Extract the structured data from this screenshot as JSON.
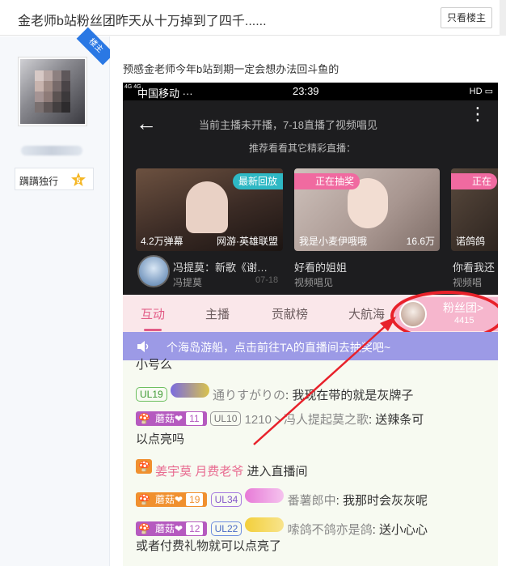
{
  "topbar": {
    "title": "金老师b站粉丝团昨天从十万掉到了四千......",
    "only_host_label": "只看楼主"
  },
  "sidebar": {
    "host_tag": "楼主",
    "level_name": "蹒蹒独行",
    "level_number": "5"
  },
  "post": {
    "text": "预感金老师今年b站到期一定会想办法回斗鱼的"
  },
  "phone": {
    "status": {
      "carrier": "中国移动 ···",
      "time": "23:39",
      "network": "4G 4G",
      "icons": "HD ▭"
    },
    "notice": {
      "line1": "当前主播未开播，7-18直播了视频唱见",
      "line2": "推荐看看其它精彩直播："
    },
    "cards": [
      {
        "tag": "最新回放",
        "stat": "4.2万弹幕",
        "category": "网游·英雄联盟",
        "title": "冯提莫：新歌《谢…",
        "sub": "冯提莫",
        "date": "07-18"
      },
      {
        "tag": "正在抽奖",
        "stat": "我是小麦伊哦哦",
        "category": "16.6万",
        "title": "好看的姐姐",
        "sub": "视频唱见"
      },
      {
        "tag": "正在",
        "stat": "诺鸽鸽",
        "title": "你看我还",
        "sub": "视频唱"
      }
    ],
    "tabs": [
      "互动",
      "主播",
      "贡献榜",
      "大航海"
    ],
    "fans": {
      "label": "粉丝团>",
      "count": "4415"
    },
    "banner": "个海岛游船，点击前往TA的直播间去抽奖吧~",
    "chat": {
      "l0": "小号么",
      "l1": {
        "ul": "UL19",
        "nick": "通りすがりの",
        "msg": ": 我现在带的就是灰牌子"
      },
      "l2": {
        "fan": "蘑菇",
        "lvl": "11",
        "ul": "UL10",
        "nick": "1210丶冯人提起莫之歌",
        "msg": ": 送辣条可",
        "cont": "以点亮吗"
      },
      "l3": {
        "name": "姜宇莫 月费老爷",
        "msg": "进入直播间"
      },
      "l4": {
        "fan": "蘑菇",
        "lvl": "19",
        "ul": "UL34",
        "nick": "番薯郎中",
        "msg": ": 我那时会灰灰呢"
      },
      "l5": {
        "fan": "蘑菇",
        "lvl": "12",
        "ul": "UL22",
        "nick": "嗦鸽不鸽亦是鸽",
        "msg": ": 送小心心",
        "cont": "或者付费礼物就可以点亮了"
      }
    }
  }
}
